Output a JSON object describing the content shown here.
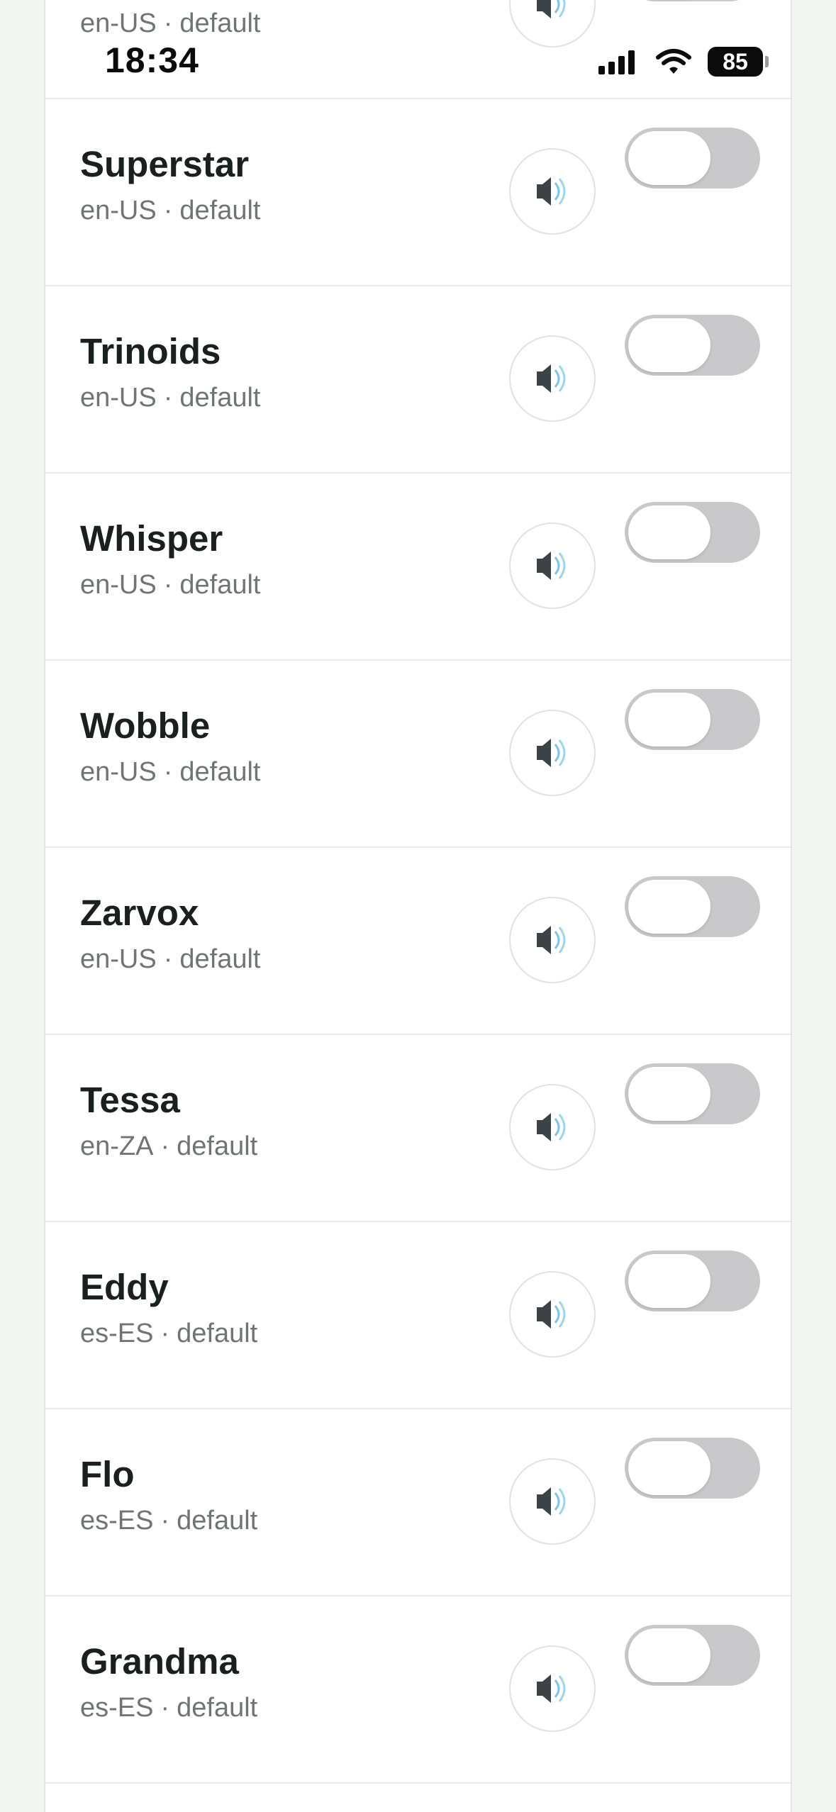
{
  "status_bar": {
    "time": "18:34",
    "battery": "85"
  },
  "partial_row": {
    "meta_lang": "en-US",
    "meta_sep": "·",
    "meta_type": "default"
  },
  "voices": [
    {
      "name": "Superstar",
      "lang": "en-US",
      "sep": "·",
      "type": "default"
    },
    {
      "name": "Trinoids",
      "lang": "en-US",
      "sep": "·",
      "type": "default"
    },
    {
      "name": "Whisper",
      "lang": "en-US",
      "sep": "·",
      "type": "default"
    },
    {
      "name": "Wobble",
      "lang": "en-US",
      "sep": "·",
      "type": "default"
    },
    {
      "name": "Zarvox",
      "lang": "en-US",
      "sep": "·",
      "type": "default"
    },
    {
      "name": "Tessa",
      "lang": "en-ZA",
      "sep": "·",
      "type": "default"
    },
    {
      "name": "Eddy",
      "lang": "es-ES",
      "sep": "·",
      "type": "default"
    },
    {
      "name": "Flo",
      "lang": "es-ES",
      "sep": "·",
      "type": "default"
    },
    {
      "name": "Grandma",
      "lang": "es-ES",
      "sep": "·",
      "type": "default"
    }
  ],
  "toggle_state": "off",
  "colors": {
    "toggle_off": "#c9c9cb",
    "background": "#f3f5f1",
    "panel": "#ffffff"
  },
  "icons": {
    "preview": "speaker-icon"
  }
}
